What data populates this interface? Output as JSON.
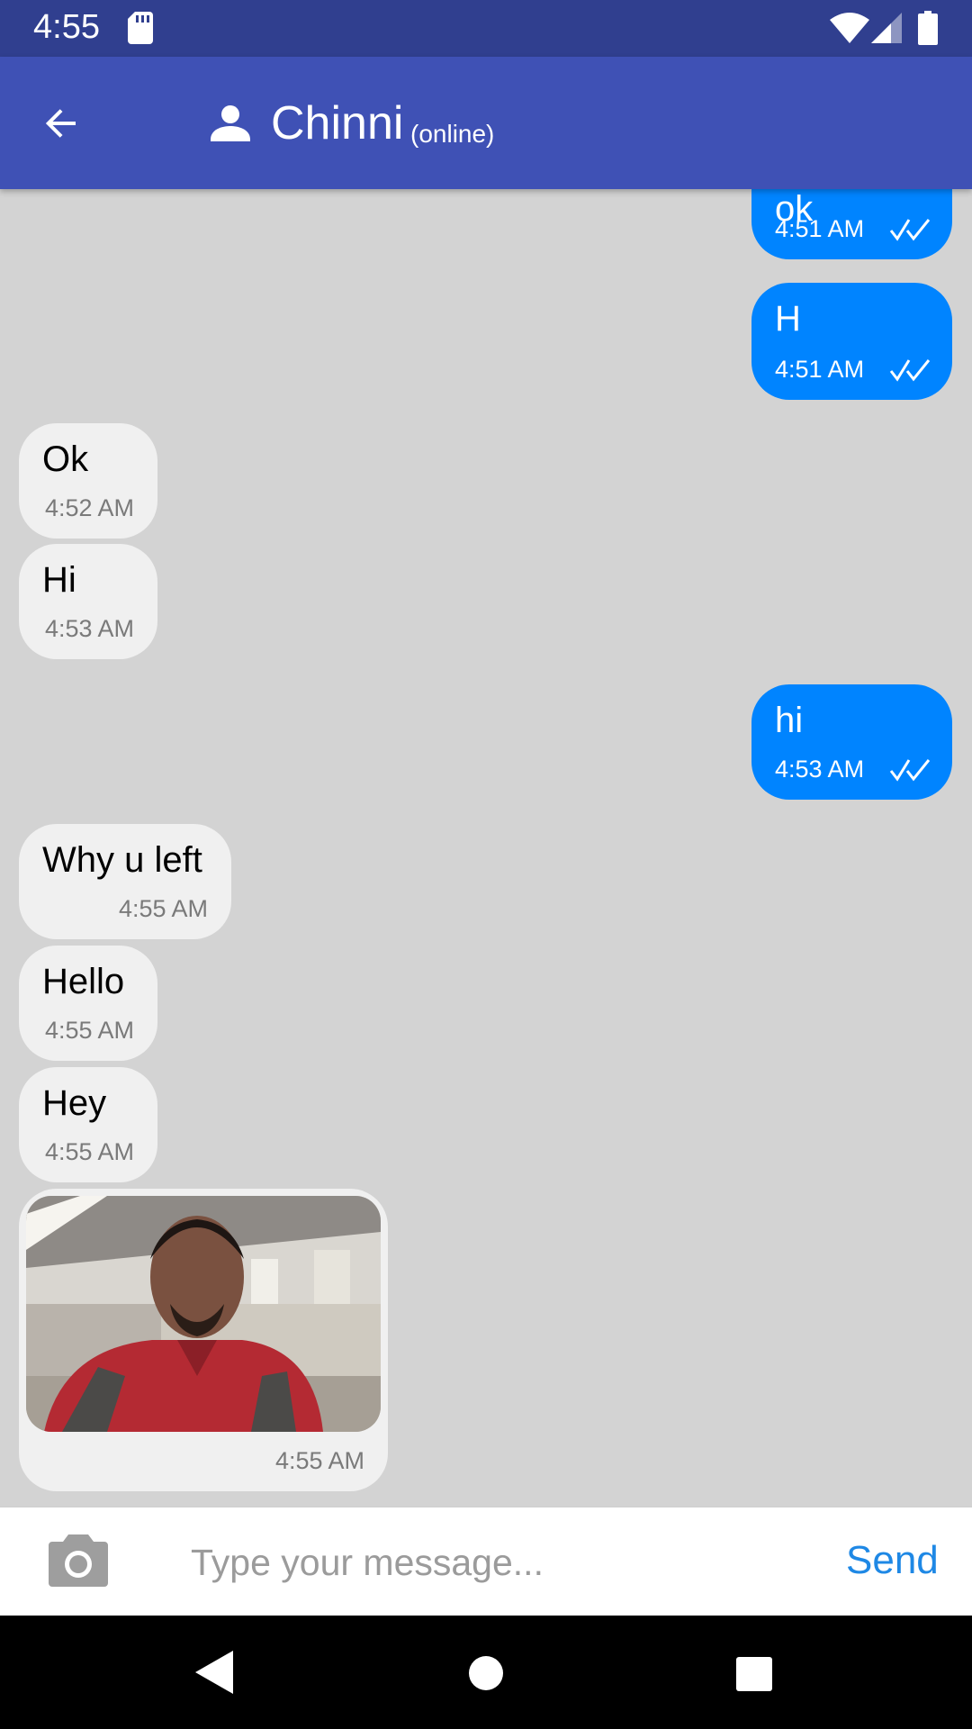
{
  "status_bar": {
    "time": "4:55"
  },
  "header": {
    "contact_name": "Chinni",
    "presence": "(online)"
  },
  "messages": [
    {
      "direction": "out",
      "text": "ok",
      "time": "4:51 AM"
    },
    {
      "direction": "out",
      "text": "H",
      "time": "4:51 AM"
    },
    {
      "direction": "in",
      "text": "Ok",
      "time": "4:52 AM"
    },
    {
      "direction": "in",
      "text": "Hi",
      "time": "4:53 AM"
    },
    {
      "direction": "out",
      "text": "hi",
      "time": "4:53 AM"
    },
    {
      "direction": "in",
      "text": "Why u left",
      "time": "4:55 AM"
    },
    {
      "direction": "in",
      "text": "Hello",
      "time": "4:55 AM"
    },
    {
      "direction": "in",
      "text": "Hey",
      "time": "4:55 AM"
    },
    {
      "direction": "in",
      "type": "image",
      "time": "4:55 AM"
    }
  ],
  "composer": {
    "placeholder": "Type your message...",
    "send_label": "Send"
  },
  "colors": {
    "app_bar": "#3f51b5",
    "status_bar": "#303f8f",
    "outgoing_bubble": "#0084ff",
    "incoming_bubble": "#f0f0f0",
    "send": "#1e88e5"
  }
}
